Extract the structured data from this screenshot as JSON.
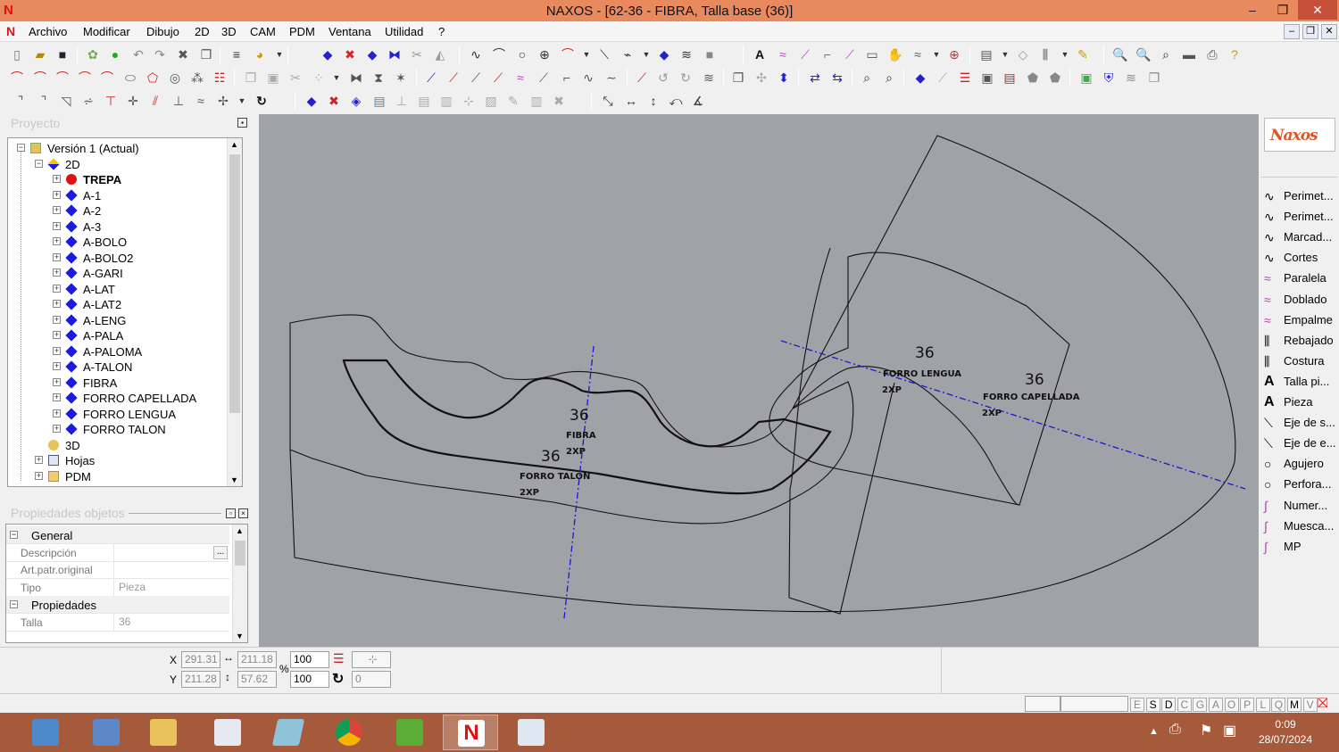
{
  "window": {
    "title": "NAXOS - [62-36 - FIBRA, Talla base (36)]",
    "app_logo": "N",
    "minimize": "–",
    "restore": "❐",
    "close": "✕"
  },
  "menu": {
    "logo": "N",
    "items": [
      "Archivo",
      "Modificar",
      "Dibujo",
      "2D",
      "3D",
      "CAM",
      "PDM",
      "Ventana",
      "Utilidad",
      "?"
    ],
    "mdi_buttons": [
      "–",
      "❐",
      "✕"
    ]
  },
  "project_panel": {
    "title": "Proyecto",
    "tree": [
      {
        "label": "Versión 1 (Actual)",
        "icon": "version-icon",
        "level": 0,
        "exp": "−"
      },
      {
        "label": "2D",
        "icon": "2d-icon",
        "level": 1,
        "exp": "−"
      },
      {
        "label": "TREPA",
        "icon": "red-dot-icon",
        "level": 2,
        "exp": "+",
        "bold": true
      },
      {
        "label": "A-1",
        "icon": "blue-diamond-icon",
        "level": 2,
        "exp": "+"
      },
      {
        "label": "A-2",
        "icon": "blue-diamond-icon",
        "level": 2,
        "exp": "+"
      },
      {
        "label": "A-3",
        "icon": "blue-diamond-icon",
        "level": 2,
        "exp": "+"
      },
      {
        "label": "A-BOLO",
        "icon": "blue-diamond-icon",
        "level": 2,
        "exp": "+"
      },
      {
        "label": "A-BOLO2",
        "icon": "blue-diamond-icon",
        "level": 2,
        "exp": "+"
      },
      {
        "label": "A-GARI",
        "icon": "blue-diamond-icon",
        "level": 2,
        "exp": "+"
      },
      {
        "label": "A-LAT",
        "icon": "blue-diamond-icon",
        "level": 2,
        "exp": "+"
      },
      {
        "label": "A-LAT2",
        "icon": "blue-diamond-icon",
        "level": 2,
        "exp": "+"
      },
      {
        "label": "A-LENG",
        "icon": "blue-diamond-icon",
        "level": 2,
        "exp": "+"
      },
      {
        "label": "A-PALA",
        "icon": "blue-diamond-icon",
        "level": 2,
        "exp": "+"
      },
      {
        "label": "A-PALOMA",
        "icon": "blue-diamond-icon",
        "level": 2,
        "exp": "+"
      },
      {
        "label": "A-TALON",
        "icon": "blue-diamond-icon",
        "level": 2,
        "exp": "+"
      },
      {
        "label": "FIBRA",
        "icon": "blue-diamond-icon",
        "level": 2,
        "exp": "+"
      },
      {
        "label": "FORRO CAPELLADA",
        "icon": "blue-diamond-icon",
        "level": 2,
        "exp": "+"
      },
      {
        "label": "FORRO LENGUA",
        "icon": "blue-diamond-icon",
        "level": 2,
        "exp": "+"
      },
      {
        "label": "FORRO TALON",
        "icon": "blue-diamond-icon",
        "level": 2,
        "exp": "+"
      },
      {
        "label": "3D",
        "icon": "3d-icon",
        "level": 1,
        "exp": ""
      },
      {
        "label": "Hojas",
        "icon": "sheets-icon",
        "level": 1,
        "exp": "+"
      },
      {
        "label": "PDM",
        "icon": "folder-icon",
        "level": 1,
        "exp": "+"
      }
    ]
  },
  "properties_panel": {
    "title": "Propiedades objetos",
    "rows": [
      {
        "type": "group",
        "label": "General"
      },
      {
        "type": "prop",
        "label": "Descripción",
        "value": "",
        "button": "..."
      },
      {
        "type": "prop",
        "label": "Art.patr.original",
        "value": ""
      },
      {
        "type": "prop",
        "label": "Tipo",
        "value": "Pieza"
      },
      {
        "type": "group",
        "label": "Propiedades"
      },
      {
        "type": "prop",
        "label": "Talla",
        "value": "36"
      }
    ]
  },
  "canvas_labels": {
    "fibra": {
      "size": "36",
      "name": "FIBRA",
      "qty": "2XP"
    },
    "forro_talon": {
      "size": "36",
      "name": "FORRO TALON",
      "qty": "2XP"
    },
    "forro_lengua": {
      "size": "36",
      "name": "FORRO LENGUA",
      "qty": "2XP"
    },
    "forro_capellada": {
      "size": "36",
      "name": "FORRO CAPELLADA",
      "qty": "2XP"
    }
  },
  "right_panel": {
    "brand": "Naxos",
    "tools": [
      {
        "icon": "curve-icon",
        "glyph": "∿",
        "label": "Perimet..."
      },
      {
        "icon": "curve-icon",
        "glyph": "∿",
        "label": "Perimet..."
      },
      {
        "icon": "curve-icon",
        "glyph": "∿",
        "label": "Marcad..."
      },
      {
        "icon": "curve-icon",
        "glyph": "∿",
        "label": "Cortes"
      },
      {
        "icon": "parallel-icon",
        "glyph": "≈",
        "label": "Paralela"
      },
      {
        "icon": "fold-icon",
        "glyph": "≈",
        "label": "Doblado"
      },
      {
        "icon": "join-icon",
        "glyph": "≈",
        "label": "Empalme"
      },
      {
        "icon": "skive-icon",
        "glyph": "⫼",
        "label": "Rebajado"
      },
      {
        "icon": "seam-icon",
        "glyph": "⫼",
        "label": "Costura"
      },
      {
        "icon": "text-icon",
        "glyph": "A",
        "label": "Talla pi..."
      },
      {
        "icon": "text-icon",
        "glyph": "A",
        "label": "Pieza"
      },
      {
        "icon": "axis-icon",
        "glyph": "⟍",
        "label": "Eje de s..."
      },
      {
        "icon": "axis-icon",
        "glyph": "⟍",
        "label": "Eje de e..."
      },
      {
        "icon": "hole-icon",
        "glyph": "○",
        "label": "Agujero"
      },
      {
        "icon": "hole-icon",
        "glyph": "○",
        "label": "Perfora..."
      },
      {
        "icon": "number-icon",
        "glyph": "∫",
        "label": "Numer..."
      },
      {
        "icon": "notch-icon",
        "glyph": "∫",
        "label": "Muesca..."
      },
      {
        "icon": "mp-icon",
        "glyph": "∫",
        "label": "MP"
      }
    ]
  },
  "coords": {
    "x_label": "X",
    "y_label": "Y",
    "x": "291.31",
    "y": "211.28",
    "width": "211.18",
    "height": "57.62",
    "percent_sign": "%",
    "scale_x": "100",
    "scale_y": "100",
    "rotation": "0"
  },
  "status_letters": [
    "E",
    "S",
    "D",
    "C",
    "G",
    "A",
    "O",
    "P",
    "L",
    "Q",
    "M",
    "V"
  ],
  "taskbar": {
    "time": "0:09",
    "date": "28/07/2024"
  },
  "colors": {
    "titlebar": "#e98a5e",
    "canvas": "#a1a2a7",
    "taskbar": "#a65a3c",
    "axis_line": "#1818d0"
  }
}
